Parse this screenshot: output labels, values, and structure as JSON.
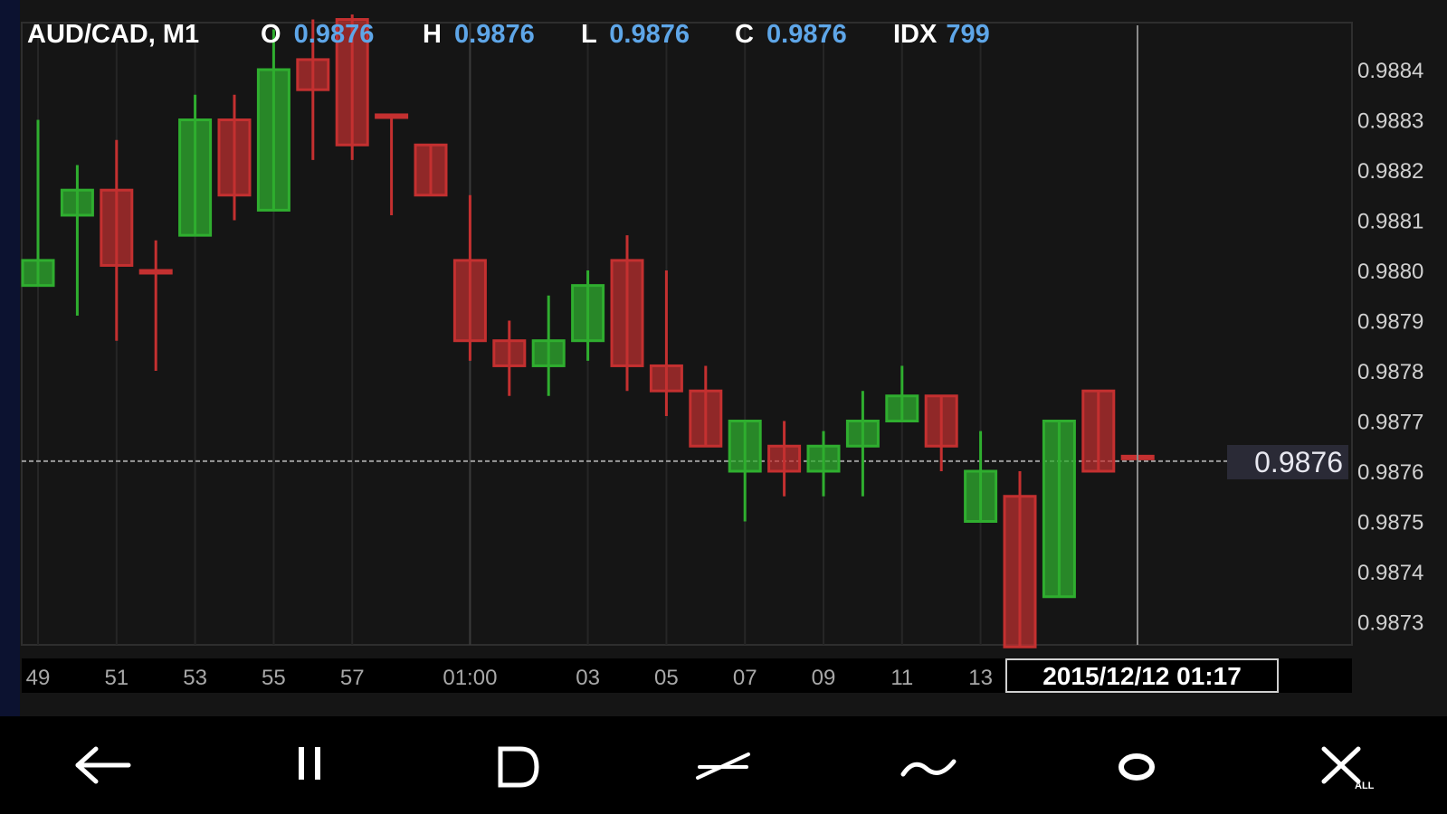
{
  "header": {
    "symbol": "AUD/CAD, M1",
    "open_label": "O",
    "open_value": "0.9876",
    "high_label": "H",
    "high_value": "0.9876",
    "low_label": "L",
    "low_value": "0.9876",
    "close_label": "C",
    "close_value": "0.9876",
    "idx_label": "IDX",
    "idx_value": "799"
  },
  "price_tag": "0.9876",
  "crosshair_time": "2015/12/12 01:17",
  "colors": {
    "up": "#2fae2f",
    "down": "#c43030",
    "header_value": "#5ea6e8",
    "background": "#151515"
  },
  "toolbar": {
    "icons": [
      "back-arrow-icon",
      "pause-icon",
      "d-shape-icon",
      "trendline-icon",
      "wave-curve-icon",
      "circle-icon",
      "close-all-icon"
    ],
    "close_all_caption": "ALL"
  },
  "chart_data": {
    "type": "candlestick",
    "y_ticks": [
      "0.9884",
      "0.9883",
      "0.9882",
      "0.9881",
      "0.9880",
      "0.9879",
      "0.9878",
      "0.9877",
      "0.9876",
      "0.9875",
      "0.9874",
      "0.9873"
    ],
    "x_ticks": [
      {
        "label": "49",
        "i": 0
      },
      {
        "label": "51",
        "i": 2
      },
      {
        "label": "53",
        "i": 4
      },
      {
        "label": "55",
        "i": 6
      },
      {
        "label": "57",
        "i": 8
      },
      {
        "label": "01:00",
        "i": 11
      },
      {
        "label": "03",
        "i": 14
      },
      {
        "label": "05",
        "i": 16
      },
      {
        "label": "07",
        "i": 18
      },
      {
        "label": "09",
        "i": 20
      },
      {
        "label": "11",
        "i": 22
      },
      {
        "label": "13",
        "i": 24
      }
    ],
    "ylim": [
      0.98725,
      0.98855
    ],
    "current_price": 0.98762,
    "candles": [
      {
        "o": 0.98797,
        "h": 0.9883,
        "l": 0.98797,
        "c": 0.98802
      },
      {
        "o": 0.98811,
        "h": 0.98821,
        "l": 0.98791,
        "c": 0.98816
      },
      {
        "o": 0.98816,
        "h": 0.98826,
        "l": 0.98786,
        "c": 0.98801
      },
      {
        "o": 0.988,
        "h": 0.98806,
        "l": 0.9878,
        "c": 0.988
      },
      {
        "o": 0.98807,
        "h": 0.98835,
        "l": 0.98807,
        "c": 0.9883
      },
      {
        "o": 0.9883,
        "h": 0.98835,
        "l": 0.9881,
        "c": 0.98815
      },
      {
        "o": 0.98812,
        "h": 0.98848,
        "l": 0.98812,
        "c": 0.9884
      },
      {
        "o": 0.98842,
        "h": 0.9885,
        "l": 0.98822,
        "c": 0.98836
      },
      {
        "o": 0.9885,
        "h": 0.98851,
        "l": 0.98822,
        "c": 0.98825
      },
      {
        "o": 0.98831,
        "h": 0.98831,
        "l": 0.98811,
        "c": 0.98831
      },
      {
        "o": 0.98825,
        "h": 0.98825,
        "l": 0.98815,
        "c": 0.98815
      },
      {
        "o": 0.98802,
        "h": 0.98815,
        "l": 0.98782,
        "c": 0.98786
      },
      {
        "o": 0.98786,
        "h": 0.9879,
        "l": 0.98775,
        "c": 0.98781
      },
      {
        "o": 0.98781,
        "h": 0.98795,
        "l": 0.98775,
        "c": 0.98786
      },
      {
        "o": 0.98786,
        "h": 0.988,
        "l": 0.98782,
        "c": 0.98797
      },
      {
        "o": 0.98802,
        "h": 0.98807,
        "l": 0.98776,
        "c": 0.98781
      },
      {
        "o": 0.98781,
        "h": 0.988,
        "l": 0.98771,
        "c": 0.98776
      },
      {
        "o": 0.98776,
        "h": 0.98781,
        "l": 0.98765,
        "c": 0.98765
      },
      {
        "o": 0.9876,
        "h": 0.9877,
        "l": 0.9875,
        "c": 0.9877
      },
      {
        "o": 0.98765,
        "h": 0.9877,
        "l": 0.98755,
        "c": 0.9876
      },
      {
        "o": 0.9876,
        "h": 0.98768,
        "l": 0.98755,
        "c": 0.98765
      },
      {
        "o": 0.98765,
        "h": 0.98776,
        "l": 0.98755,
        "c": 0.9877
      },
      {
        "o": 0.9877,
        "h": 0.98781,
        "l": 0.9877,
        "c": 0.98775
      },
      {
        "o": 0.98775,
        "h": 0.98775,
        "l": 0.9876,
        "c": 0.98765
      },
      {
        "o": 0.9875,
        "h": 0.98768,
        "l": 0.9875,
        "c": 0.9876
      },
      {
        "o": 0.98755,
        "h": 0.9876,
        "l": 0.98725,
        "c": 0.98725
      },
      {
        "o": 0.98735,
        "h": 0.9877,
        "l": 0.98735,
        "c": 0.9877
      },
      {
        "o": 0.98776,
        "h": 0.98776,
        "l": 0.9876,
        "c": 0.9876
      },
      {
        "o": 0.98763,
        "h": 0.98763,
        "l": 0.98763,
        "c": 0.98763
      }
    ]
  }
}
